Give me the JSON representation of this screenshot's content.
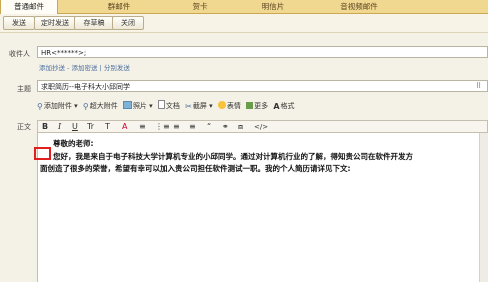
{
  "tabs": [
    {
      "label": "普通邮件",
      "active": true
    },
    {
      "label": "群邮件",
      "active": false
    },
    {
      "label": "贺卡",
      "active": false
    },
    {
      "label": "明信片",
      "active": false
    },
    {
      "label": "音视频邮件",
      "active": false
    }
  ],
  "toolbar": {
    "send": "发送",
    "scheduled_send": "定时发送",
    "save_draft": "存草稿",
    "close": "关闭"
  },
  "form": {
    "recipient_label": "收件人",
    "recipient_value": "HR<******>;",
    "cc_links": [
      "添加抄送",
      "添加密送",
      "分别发送"
    ],
    "subject_label": "主题",
    "subject_value": "求职简历--电子科大小邱同学",
    "body_label": "正文"
  },
  "attachments": {
    "add_attachment": "添加附件",
    "large_attachment": "超大附件",
    "photo": "照片",
    "document": "文档",
    "screenshot": "截屏",
    "emoji": "表情",
    "more": "更多",
    "format": "格式"
  },
  "format_bar": [
    "B",
    "I",
    "U",
    "Tr",
    "T",
    "A",
    "≡",
    "⋮≡",
    "≡",
    "≡",
    "“",
    "⚭",
    "⧈",
    "</>"
  ],
  "body": {
    "greeting": "尊敬的老师:",
    "line1": "您好，我是来自于电子科技大学计算机专业的小邱同学。通过对计算机行业的了解，得知贵公司在软件开发方",
    "line2": "面创造了很多的荣誉，希望有幸可以加入贵公司担任软件测试一职。我的个人简历请详见下文:"
  },
  "colors": {
    "tab_bar": "#f0d890",
    "highlight_box": "#e0201e",
    "link": "#4a6d9e"
  }
}
